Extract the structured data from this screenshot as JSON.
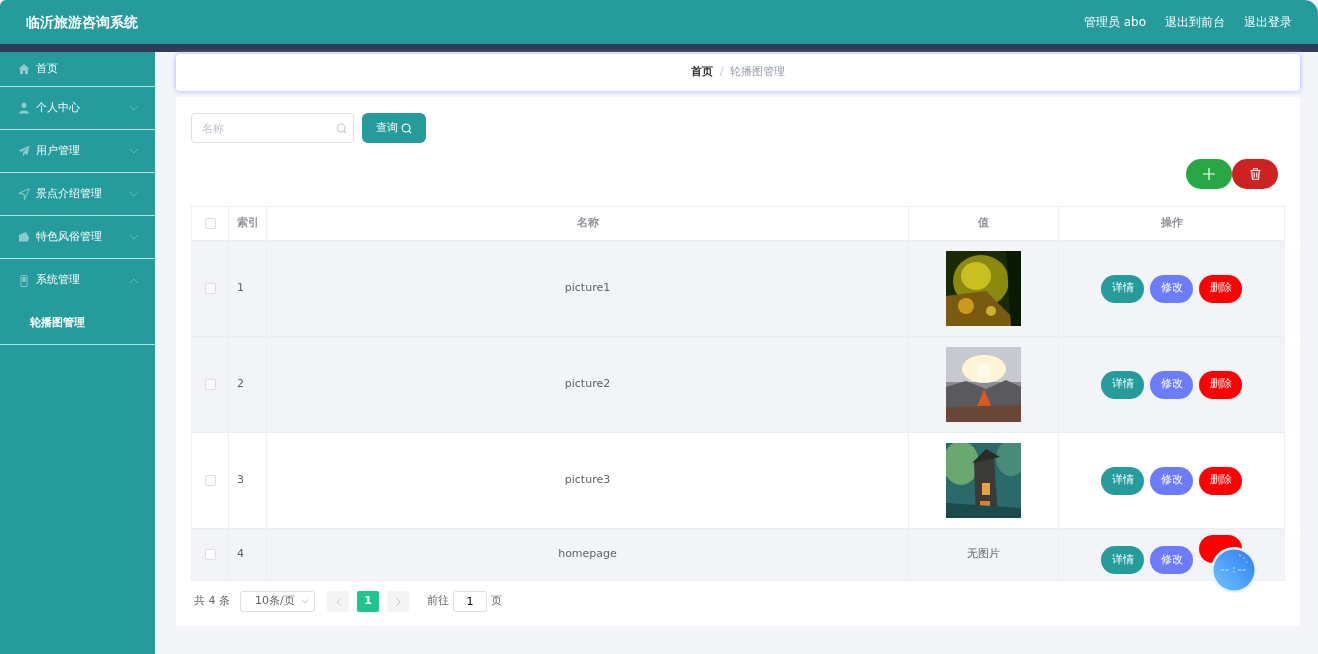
{
  "header": {
    "title": "临沂旅游咨询系统",
    "links": [
      "管理员 abo",
      "退出到前台",
      "退出登录"
    ]
  },
  "sidebar": {
    "items": [
      {
        "label": "首页",
        "kind": "link"
      },
      {
        "label": "个人中心",
        "kind": "menu",
        "expanded": false
      },
      {
        "label": "用户管理",
        "kind": "menu",
        "expanded": false
      },
      {
        "label": "景点介绍管理",
        "kind": "menu",
        "expanded": false
      },
      {
        "label": "特色风俗管理",
        "kind": "menu",
        "expanded": false
      },
      {
        "label": "系统管理",
        "kind": "menu",
        "expanded": true,
        "children": [
          {
            "label": "轮播图管理"
          }
        ]
      }
    ]
  },
  "breadcrumb": {
    "separator": "/",
    "items": [
      "首页",
      "轮播图管理"
    ]
  },
  "search": {
    "placeholder": "名称",
    "button": "查询"
  },
  "table": {
    "select_all_checked": false,
    "columns": [
      "索引",
      "名称",
      "值",
      "操作"
    ],
    "rows": [
      {
        "checked": false,
        "shaded": true,
        "index": "1",
        "name": "picture1",
        "value": {
          "kind": "picture"
        },
        "actions": [
          {
            "kind": "detail",
            "label": "详情"
          },
          {
            "kind": "edit",
            "label": "修改"
          },
          {
            "kind": "delete",
            "label": "删除"
          }
        ]
      },
      {
        "checked": false,
        "shaded": true,
        "index": "2",
        "name": "picture2",
        "value": {
          "kind": "picture"
        },
        "actions": [
          {
            "kind": "detail",
            "label": "详情"
          },
          {
            "kind": "edit",
            "label": "修改"
          },
          {
            "kind": "delete",
            "label": "删除"
          }
        ]
      },
      {
        "checked": false,
        "shaded": false,
        "index": "3",
        "name": "picture3",
        "value": {
          "kind": "picture"
        },
        "actions": [
          {
            "kind": "detail",
            "label": "详情"
          },
          {
            "kind": "edit",
            "label": "修改"
          },
          {
            "kind": "delete",
            "label": "删除"
          }
        ]
      },
      {
        "checked": false,
        "shaded": true,
        "index": "4",
        "name": "homepage",
        "value": {
          "kind": "text",
          "text": "无图片"
        },
        "actions": [
          {
            "kind": "detail",
            "label": "详情"
          },
          {
            "kind": "edit",
            "label": "修改"
          },
          {
            "kind": "delete"
          }
        ]
      }
    ]
  },
  "pagination": {
    "total": "共 4 条",
    "page_size": "10条/页",
    "pages": [
      {
        "label": "1",
        "selected": true
      }
    ],
    "goto_label": "前往",
    "goto_value": "1",
    "goto_suffix": "页"
  }
}
